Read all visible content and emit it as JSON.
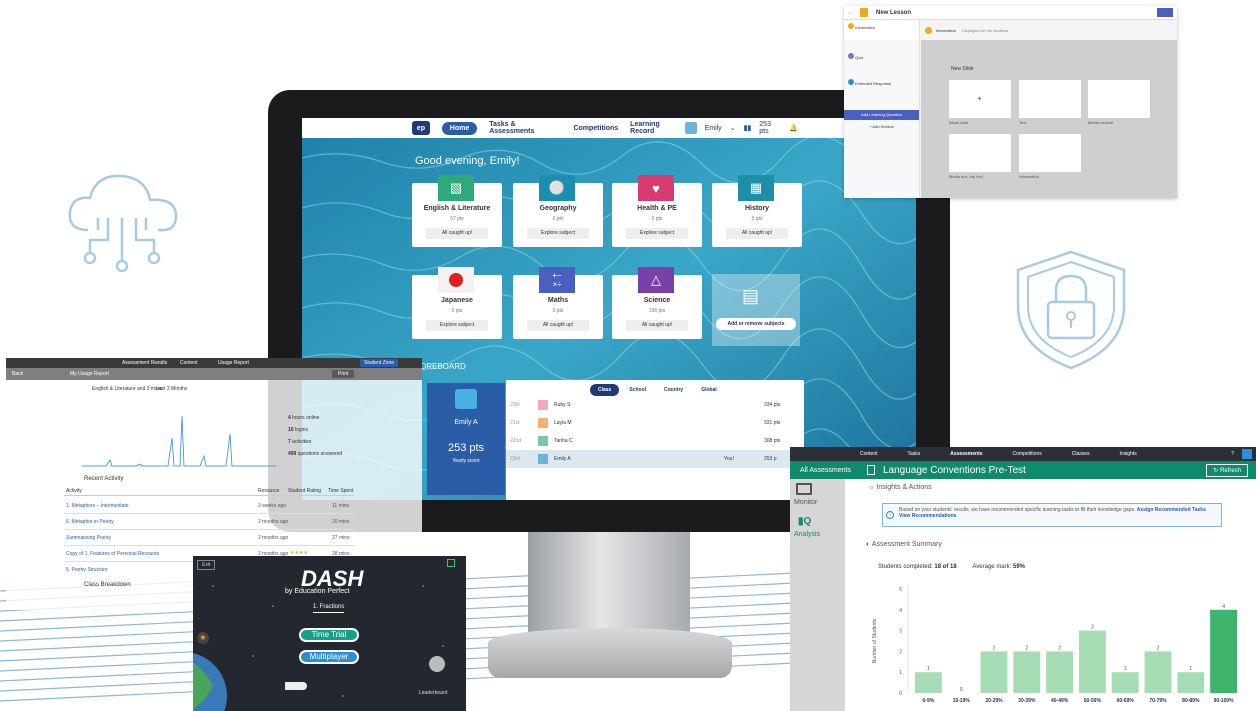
{
  "colors": {
    "brand_navy": "#1f3a76",
    "brand_blue": "#2a5ca8",
    "assess_green": "#0f8a6b",
    "bar_green": "#7fcf9a"
  },
  "dashboard": {
    "nav": {
      "logo": "ep",
      "tabs": [
        "Home",
        "Tasks & Assessments",
        "Competitions",
        "Learning Record"
      ],
      "user": "Emily",
      "points": "253 pts"
    },
    "greeting": "Good evening, Emily!",
    "subjects": [
      {
        "name": "English & Literature",
        "pts": "57 pts",
        "button": "All caught up!",
        "color": "#2eaa7a",
        "icon": "book-icon"
      },
      {
        "name": "Geography",
        "pts": "0 pts",
        "button": "Explore subject",
        "color": "#1a8fb0",
        "icon": "globe-icon"
      },
      {
        "name": "Health & PE",
        "pts": "0 pts",
        "button": "Explore subject",
        "color": "#d93a6f",
        "icon": "heart-icon"
      },
      {
        "name": "History",
        "pts": "0 pts",
        "button": "All caught up!",
        "color": "#1e8fa6",
        "icon": "column-icon"
      },
      {
        "name": "Japanese",
        "pts": "0 pts",
        "button": "Explore subject",
        "color": "#e7e7e7",
        "icon": "flag-icon"
      },
      {
        "name": "Maths",
        "pts": "0 pts",
        "button": "All caught up!",
        "color": "#4a5fbf",
        "icon": "calculator-icon"
      },
      {
        "name": "Science",
        "pts": "196 pts",
        "button": "All caught up!",
        "color": "#7a3fa8",
        "icon": "flask-icon"
      }
    ],
    "add_subjects": "Add or remove subjects",
    "leaderboard_label": "OREBOARD",
    "me": {
      "name": "Emily A",
      "points": "253 pts",
      "period": "Yearly score"
    },
    "lb_tabs": [
      "Class",
      "School",
      "Country",
      "Global"
    ],
    "lb_rows": [
      {
        "rank": "20th",
        "name": "Ruby S",
        "extra": "",
        "pts": "334 pts"
      },
      {
        "rank": "21st",
        "name": "Layla M",
        "extra": "",
        "pts": "331 pts"
      },
      {
        "rank": "22nd",
        "name": "Tanha C",
        "extra": "",
        "pts": "308 pts"
      },
      {
        "rank": "23rd",
        "name": "Emily A",
        "extra": "You!",
        "pts": "253 p"
      }
    ]
  },
  "lesson": {
    "title": "New Lesson",
    "side_items": [
      {
        "title": "Information",
        "sub": "Teachers"
      },
      {
        "title": "Quiz",
        "sub": "Question"
      },
      {
        "title": "Extended Response",
        "sub": ""
      }
    ],
    "add_learning": "Add Learning Question",
    "add_section": "+ Add Section",
    "main_title": "Information",
    "main_sub": "Displayed for the students",
    "new_slide": "New Slide",
    "tile_labels": [
      "Blank slide",
      "Text",
      "Media vertical",
      "Media text, top text",
      "Information"
    ]
  },
  "usage": {
    "top_items": [
      "Assessment Results",
      "Content",
      "Usage Report"
    ],
    "button": "Student Zone",
    "back": "Back",
    "title": "My Usage Report",
    "print": "Print",
    "subject_filter": "English & Literature and 3 more",
    "period_filter": "Last 3 Months",
    "stats": [
      {
        "value": "4",
        "label": "hours online"
      },
      {
        "value": "10",
        "label": "logins"
      },
      {
        "value": "7",
        "label": "activities"
      },
      {
        "value": "499",
        "label": "questions answered"
      }
    ],
    "recent_title": "Recent Activity",
    "table_headers": [
      "Activity",
      "Resource",
      "Student Rating",
      "Time Spent"
    ],
    "rows": [
      {
        "activity": "1. Metaphors – Intermediate",
        "resource": "3 weeks ago",
        "time": "11 mins"
      },
      {
        "activity": "6. Metaphor in Poetry",
        "resource": "2 months ago",
        "time": "20 mins"
      },
      {
        "activity": "Summarising Poetry",
        "resource": "2 months ago",
        "time": "27 mins"
      },
      {
        "activity": "Copy of 1. Features of Personal Recounts",
        "resource": "2 months ago",
        "time": "28 mins"
      },
      {
        "activity": "5. Poetry Structure",
        "resource": "",
        "time": ""
      }
    ],
    "class_breakdown": "Class Breakdown"
  },
  "dash": {
    "exit": "Exit",
    "title": "DASH",
    "subtitle": "by Education Perfect",
    "topic": "1. Fractions",
    "time_trial": "Time Trial",
    "multiplayer": "Multiplayer",
    "leaderboard": "Leaderboard"
  },
  "assessment": {
    "top_items": [
      "Content",
      "Tasks",
      "Assessments",
      "Competitions",
      "Classes",
      "Insights"
    ],
    "back": "All Assessments",
    "title": "Language Conventions Pre-Test",
    "refresh": "Refresh",
    "side": [
      "Monitor",
      "Analysis"
    ],
    "insights_title": "Insights & Actions",
    "insight_text": "Based on your students' results, we have recommended specific learning tasks to fill their knowledge gaps.",
    "insight_link1": "Assign Recommended Tasks",
    "insight_link2": "View Recommendations",
    "summary_title": "Assessment Summary",
    "completed_label": "Students completed:",
    "completed_value": "18 of 18",
    "average_label": "Average mark:",
    "average_value": "59%"
  },
  "chart_data": {
    "type": "bar",
    "categories": [
      "0-9%",
      "10-19%",
      "20-29%",
      "30-39%",
      "40-49%",
      "50-59%",
      "60-69%",
      "70-79%",
      "80-89%",
      "90-100%"
    ],
    "values": [
      1,
      0,
      2,
      2,
      2,
      3,
      1,
      2,
      1,
      4
    ],
    "ylabel": "Number of Students",
    "yticks": [
      0,
      1,
      2,
      3,
      4,
      5
    ],
    "ylim": [
      0,
      5
    ],
    "grid": false
  }
}
